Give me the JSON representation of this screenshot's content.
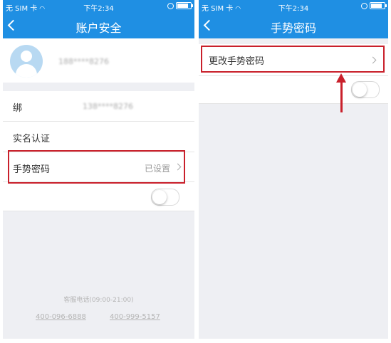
{
  "left": {
    "status": {
      "carrier": "无 SIM 卡",
      "time": "下午2:34"
    },
    "nav": {
      "title": "账户安全"
    },
    "profile": {
      "masked_phone": "188****8276"
    },
    "rows": {
      "row1_label": "绑",
      "row1_masked": "138****8276",
      "realname_label": "实名认证",
      "gesture_label": "手势密码",
      "gesture_value": "已设置"
    },
    "footer": {
      "hotline_label": "客服电话(09:00-21:00)",
      "phone1": "400-096-6888",
      "phone2": "400-999-5157"
    }
  },
  "right": {
    "status": {
      "carrier": "无 SIM 卡",
      "time": "下午2:34"
    },
    "nav": {
      "title": "手势密码"
    },
    "rows": {
      "change_label": "更改手势密码"
    }
  },
  "colors": {
    "accent": "#1f8fe3",
    "highlight": "#c9202b",
    "background": "#eeeff3"
  },
  "toggles": {
    "left_on": false,
    "right_on": false
  }
}
